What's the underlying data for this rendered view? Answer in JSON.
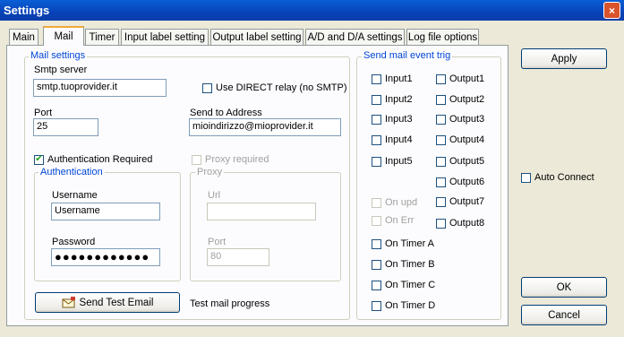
{
  "window": {
    "title": "Settings",
    "close_glyph": "×"
  },
  "tabs": [
    {
      "label": "Main"
    },
    {
      "label": "Mail",
      "active": true
    },
    {
      "label": "Timer"
    },
    {
      "label": "Input label setting"
    },
    {
      "label": "Output label setting"
    },
    {
      "label": "A/D and D/A settings"
    },
    {
      "label": "Log file options"
    }
  ],
  "mail_settings": {
    "group_label": "Mail settings",
    "smtp_label": "Smtp server",
    "smtp_value": "smtp.tuoprovider.it",
    "direct_relay": {
      "label": "Use DIRECT relay (no SMTP)",
      "checked": false
    },
    "port_label": "Port",
    "port_value": "25",
    "send_to_label": "Send to Address",
    "send_to_value": "mioindirizzo@mioprovider.it",
    "auth_required": {
      "label": "Authentication Required",
      "checked": true,
      "check_glyph": "✔"
    },
    "proxy_required": {
      "label": "Proxy required",
      "checked": false,
      "enabled": false
    },
    "authentication": {
      "group_label": "Authentication",
      "username_label": "Username",
      "username_value": "Username",
      "password_label": "Password",
      "password_value": "●●●●●●●●●●●●"
    },
    "proxy": {
      "group_label": "Proxy",
      "url_label": "Url",
      "url_value": "",
      "port_label": "Port",
      "port_value": "80"
    },
    "test_button": {
      "label": "Send Test Email",
      "icon": "mail-send-icon"
    },
    "progress_label": "Test mail progress"
  },
  "send_trig": {
    "group_label": "Send mail event trig",
    "inputs": [
      "Input1",
      "Input2",
      "Input3",
      "Input4",
      "Input5"
    ],
    "outputs": [
      "Output1",
      "Output2",
      "Output3",
      "Output4",
      "Output5",
      "Output6",
      "Output7",
      "Output8"
    ],
    "on_upd": "On upd",
    "on_err": "On Err",
    "timers": [
      "On Timer A",
      "On Timer B",
      "On Timer C",
      "On Timer D"
    ]
  },
  "right_panel": {
    "apply_label": "Apply",
    "auto_connect": {
      "label": "Auto Connect",
      "checked": false
    },
    "ok_label": "OK",
    "cancel_label": "Cancel"
  },
  "colors": {
    "title_bar": "#0a4fd0",
    "group_label": "#0046d5",
    "tab_active_accent": "#f1a83c",
    "checkmark": "#21a121"
  }
}
